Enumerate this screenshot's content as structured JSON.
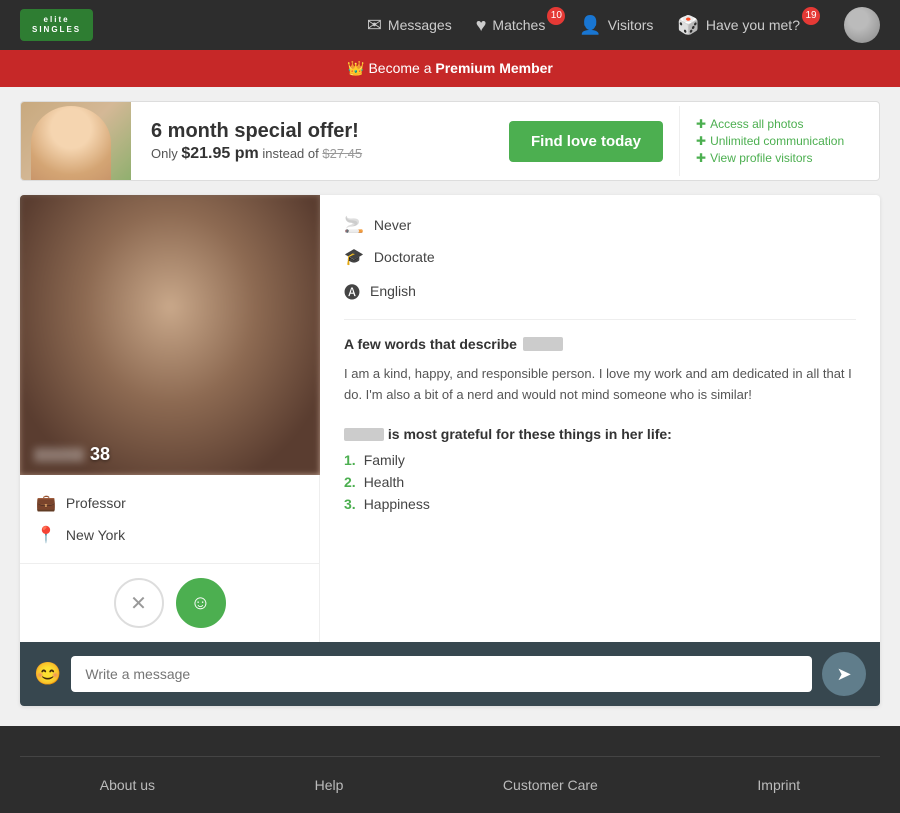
{
  "header": {
    "logo": "elite",
    "logo_sub": "SINGLES",
    "nav": [
      {
        "label": "Messages",
        "icon": "✉",
        "badge": null
      },
      {
        "label": "Matches",
        "icon": "♥",
        "badge": "10"
      },
      {
        "label": "Visitors",
        "icon": "👤",
        "badge": null
      },
      {
        "label": "Have you met?",
        "icon": "🎲",
        "badge": "19"
      }
    ]
  },
  "premium_banner": {
    "text": "Become a ",
    "highlight": "Premium Member"
  },
  "offer": {
    "title": "6 month special offer!",
    "subtitle": "Only ",
    "price": "$21.95 pm",
    "old_price": "$27.45",
    "instead": " instead of ",
    "button_label": "Find love today",
    "features": [
      "Access all photos",
      "Unlimited communication",
      "View profile visitors"
    ]
  },
  "profile": {
    "age": "38",
    "occupation": "Professor",
    "location": "New York",
    "smoking": "Never",
    "education": "Doctorate",
    "language": "English",
    "bio_title": "A few words that describe",
    "bio_text": "I am a kind, happy, and responsible person. I love my work and am dedicated in all that I do. I'm also a bit of a nerd and would not mind someone who is similar!",
    "grateful_title": "is most grateful for these things in her life:",
    "grateful_items": [
      "Family",
      "Health",
      "Happiness"
    ]
  },
  "message": {
    "placeholder": "Write a message"
  },
  "footer": {
    "links": [
      "About us",
      "Help",
      "Customer Care",
      "Imprint"
    ]
  }
}
